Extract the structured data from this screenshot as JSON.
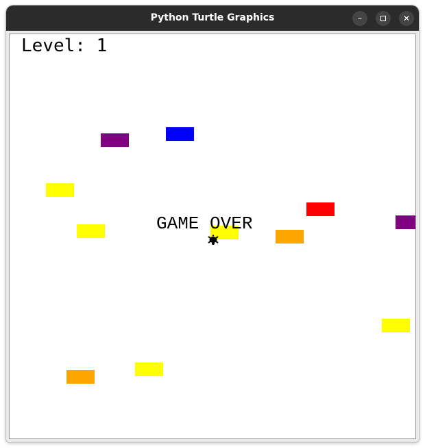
{
  "window": {
    "title": "Python Turtle Graphics",
    "controls": {
      "minimize": "–",
      "close": "✕"
    }
  },
  "game": {
    "level_text": "Level: 1",
    "status_text": "GAME OVER",
    "player_icon": "turtle-icon",
    "block_colors": {
      "purple": "#800080",
      "blue": "#0000ff",
      "yellow": "#ffff00",
      "red": "#ff0000",
      "orange": "#ffa500"
    }
  }
}
